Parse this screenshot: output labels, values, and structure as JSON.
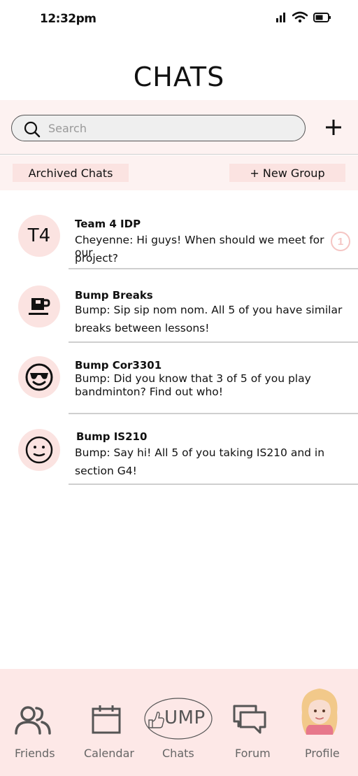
{
  "status_bar": {
    "time": "12:32pm"
  },
  "page": {
    "title": "CHATS"
  },
  "search": {
    "placeholder": "Search"
  },
  "actions": {
    "archived": "Archived Chats",
    "new_group": "+ New Group"
  },
  "chats": [
    {
      "avatar_text": "T4",
      "name": "Team 4 IDP",
      "preview_line1": "Cheyenne: Hi guys! When should we meet for our",
      "preview_line2": "project?",
      "unread": "1"
    },
    {
      "avatar_icon": "coffee-cup-icon",
      "name": "Bump Breaks",
      "preview_line1": "Bump: Sip sip nom nom. All 5 of you have similar",
      "preview_line2": "breaks between lessons!"
    },
    {
      "avatar_icon": "sunglasses-face-icon",
      "name": "Bump Cor3301",
      "preview_line1": "Bump: Did you know that 3 of 5 of you play",
      "preview_line2": "bandminton? Find out who!"
    },
    {
      "avatar_icon": "smiley-face-icon",
      "name": "Bump IS210",
      "preview_line1": "Bump: Say hi! All 5 of you taking IS210 and in",
      "preview_line2": "section G4!"
    }
  ],
  "nav": {
    "friends": "Friends",
    "calendar": "Calendar",
    "chats": "Chats",
    "chats_logo": "UMP",
    "forum": "Forum",
    "profile": "Profile"
  }
}
